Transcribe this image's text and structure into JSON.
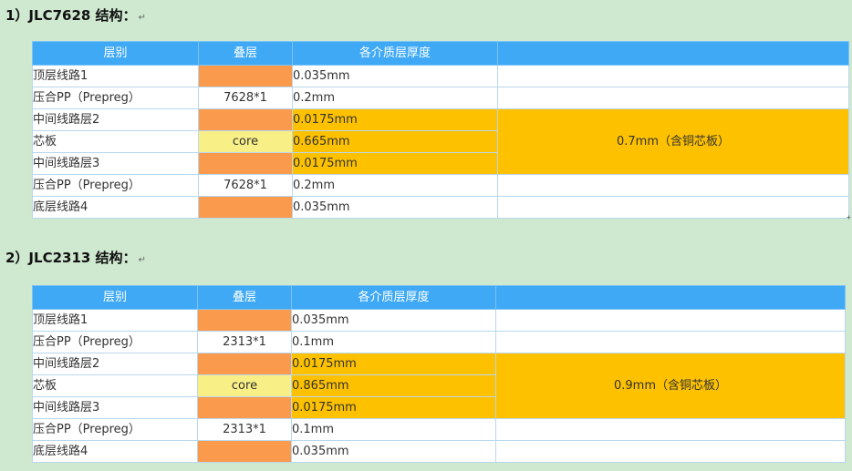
{
  "sections": [
    {
      "heading": "1）JLC7628 结构：",
      "headers": [
        "层别",
        "叠层",
        "各介质层厚度",
        ""
      ],
      "rows": [
        {
          "layer": "顶层线路1",
          "stack": "",
          "thickness": "0.035mm"
        },
        {
          "layer": "压合PP（Prepreg）",
          "stack": "7628*1",
          "thickness": "0.2mm"
        },
        {
          "layer": "中间线路层2",
          "stack": "",
          "thickness": "0.0175mm"
        },
        {
          "layer": "芯板",
          "stack": "core",
          "thickness": "0.665mm"
        },
        {
          "layer": "中间线路层3",
          "stack": "",
          "thickness": "0.0175mm"
        },
        {
          "layer": "压合PP（Prepreg）",
          "stack": "7628*1",
          "thickness": "0.2mm"
        },
        {
          "layer": "底层线路4",
          "stack": "",
          "thickness": "0.035mm"
        }
      ],
      "core_total": "0.7mm（含铜芯板）"
    },
    {
      "heading": "2）JLC2313 结构：",
      "headers": [
        "层别",
        "叠层",
        "各介质层厚度",
        ""
      ],
      "rows": [
        {
          "layer": "顶层线路1",
          "stack": "",
          "thickness": "0.035mm"
        },
        {
          "layer": "压合PP（Prepreg）",
          "stack": "2313*1",
          "thickness": "0.1mm"
        },
        {
          "layer": "中间线路层2",
          "stack": "",
          "thickness": "0.0175mm"
        },
        {
          "layer": "芯板",
          "stack": "core",
          "thickness": "0.865mm"
        },
        {
          "layer": "中间线路层3",
          "stack": "",
          "thickness": "0.0175mm"
        },
        {
          "layer": "压合PP（Prepreg）",
          "stack": "2313*1",
          "thickness": "0.1mm"
        },
        {
          "layer": "底层线路4",
          "stack": "",
          "thickness": "0.035mm"
        }
      ],
      "core_total": "0.9mm（含铜芯板）"
    }
  ],
  "colors": {
    "header_blue": "#3fa9f5",
    "copper_orange": "#f99a4c",
    "core_yellow": "#f8ef86",
    "core_gold": "#fdc100",
    "page_green": "#cfe8d0"
  },
  "paragraph_mark": "↵"
}
